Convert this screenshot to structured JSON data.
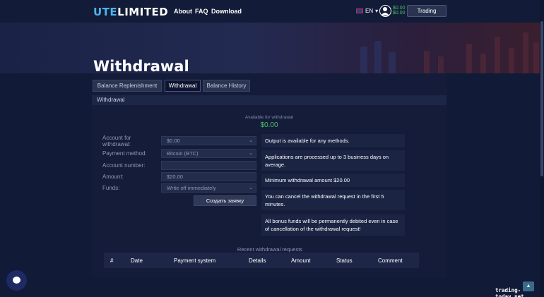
{
  "header": {
    "logo_part1": "UTE",
    "logo_part2": "LIMITED",
    "nav": [
      "About",
      "FAQ",
      "Download"
    ],
    "lang": "EN",
    "balance_line1": "$0.00",
    "balance_line2": "$0.00",
    "trading_label": "Trading"
  },
  "hero": {
    "title": "Withdrawal"
  },
  "tabs": [
    "Balance Replenishment",
    "Withdrawal",
    "Balance History"
  ],
  "section_title": "Withdrawal",
  "available": {
    "label": "Available for withdrawal",
    "value": "$0.00"
  },
  "form": {
    "account_label": "Account for withdrawal:",
    "account_value": "$0.00",
    "method_label": "Payment method:",
    "method_value": "Bitcoin (BTC)",
    "number_label": "Account number:",
    "number_value": "",
    "amount_label": "Amount:",
    "amount_value": "$20.00",
    "funds_label": "Funds:",
    "funds_value": "Write off immediately",
    "submit_label": "Создать заявку"
  },
  "notes": [
    "Output is available for any methods.",
    "Applications are processed up to 3 business days on average.",
    "Minimum withdrawal amount $20.00",
    "You can cancel the withdrawal request in the first 5 minutes.",
    "All bonus funds will be permanently debited even in case of cancellation of the withdrawal request!"
  ],
  "requests": {
    "title": "Recent withdrawal requests",
    "columns": [
      "#",
      "Date",
      "Payment system",
      "Details",
      "Amount",
      "Status",
      "Comment"
    ]
  },
  "watermark": "trading-today.net",
  "colors": {
    "accent_blue": "#4fb3e8",
    "positive_green": "#4cc26a",
    "background": "#111a36"
  }
}
